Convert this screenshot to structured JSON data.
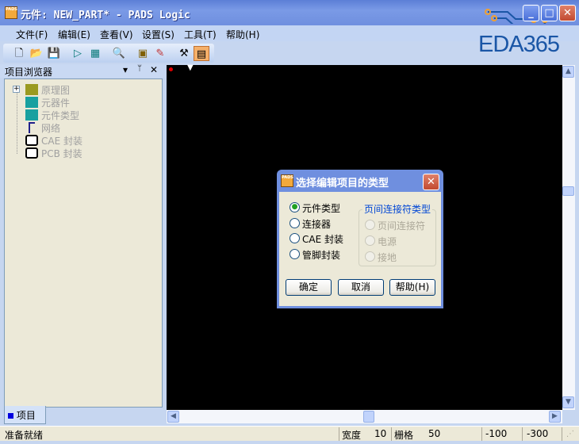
{
  "window": {
    "title": "元件: NEW_PART* - PADS Logic",
    "icon_label": "PADS",
    "brand": "EDA365"
  },
  "menu": [
    "文件(F)",
    "编辑(E)",
    "查看(V)",
    "设置(S)",
    "工具(T)",
    "帮助(H)"
  ],
  "toolbar_icons": [
    "new-file-icon",
    "open-folder-icon",
    "save-icon",
    "gate-icon",
    "chip-icon",
    "zoom-icon",
    "properties-icon",
    "brush-icon",
    "hammer-icon",
    "project-browser-icon"
  ],
  "panel": {
    "title": "项目浏览器",
    "tab": "项目",
    "tree": [
      "原理图",
      "元器件",
      "元件类型",
      "网络",
      "CAE 封装",
      "PCB 封装"
    ]
  },
  "status": {
    "ready": "准备就绪",
    "width_label": "宽度",
    "width_value": "10",
    "grid_label": "栅格",
    "grid_value": "50",
    "x": "-100",
    "y": "-300"
  },
  "dialog": {
    "title": "选择编辑项目的类型",
    "options": [
      "元件类型",
      "连接器",
      "CAE 封装",
      "管脚封装"
    ],
    "selected": 0,
    "group_title": "页间连接符类型",
    "group_options": [
      "页间连接符",
      "电源",
      "接地"
    ],
    "ok": "确定",
    "cancel": "取消",
    "help": "帮助(H)"
  },
  "colors": {
    "accent": "#0046d5",
    "canvas": "#000000",
    "brand": "#1a56a6"
  }
}
